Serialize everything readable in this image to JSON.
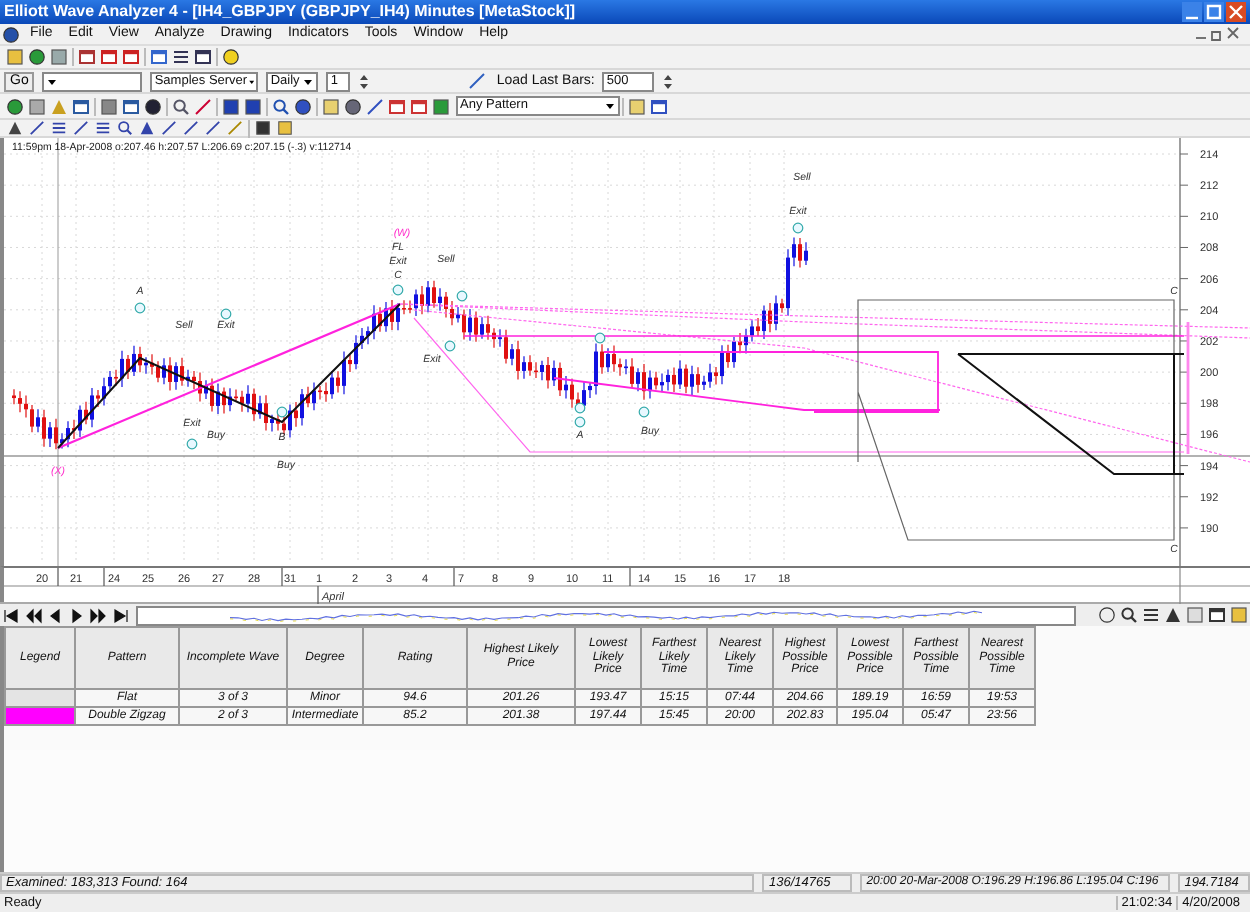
{
  "window": {
    "title": "Elliott Wave Analyzer 4 - [IH4_GBPJPY  (GBPJPY_IH4)  Minutes [MetaStock]]"
  },
  "menu": [
    "File",
    "Edit",
    "View",
    "Analyze",
    "Drawing",
    "Indicators",
    "Tools",
    "Window",
    "Help"
  ],
  "toolbar": {
    "go_button": "Go",
    "server_combo": "Samples Server",
    "period_combo": "Daily",
    "interval_field": "1",
    "load_bars_label": "Load Last Bars:",
    "load_bars_field": "500",
    "pattern_combo": "Any Pattern"
  },
  "chart": {
    "info": "11:59pm 18-Apr-2008 o:207.46 h:207.57 L:206.69 c:207.15 (-.3) v:112714",
    "y_labels": [
      "214",
      "212",
      "210",
      "208",
      "206",
      "204",
      "202",
      "200",
      "198",
      "196",
      "194",
      "192",
      "190"
    ],
    "x_labels": [
      "20",
      "21",
      "24",
      "25",
      "26",
      "27",
      "28",
      "31",
      "1",
      "2",
      "3",
      "4",
      "7",
      "8",
      "9",
      "10",
      "11",
      "14",
      "15",
      "16",
      "17",
      "18"
    ],
    "month_label": "April",
    "annotations": [
      {
        "text": "A",
        "kind": "signal"
      },
      {
        "text": "Sell",
        "kind": "signal"
      },
      {
        "text": "Exit",
        "kind": "signal"
      },
      {
        "text": "Exit",
        "kind": "signal"
      },
      {
        "text": "Buy",
        "kind": "signal"
      },
      {
        "text": "B",
        "kind": "signal"
      },
      {
        "text": "Buy",
        "kind": "signal"
      },
      {
        "text": "(W)",
        "kind": "degree"
      },
      {
        "text": "FL",
        "kind": "signal"
      },
      {
        "text": "Exit",
        "kind": "signal"
      },
      {
        "text": "C",
        "kind": "signal"
      },
      {
        "text": "Sell",
        "kind": "signal"
      },
      {
        "text": "Exit",
        "kind": "signal"
      },
      {
        "text": "A",
        "kind": "signal"
      },
      {
        "text": "Buy",
        "kind": "signal"
      },
      {
        "text": "Sell",
        "kind": "signal"
      },
      {
        "text": "Exit",
        "kind": "signal"
      },
      {
        "text": "(X)",
        "kind": "degree"
      },
      {
        "text": "C",
        "kind": "signal"
      },
      {
        "text": "C",
        "kind": "signal"
      }
    ]
  },
  "table": {
    "columns": [
      "Legend",
      "Pattern",
      "Incomplete Wave",
      "Degree",
      "Rating",
      "Highest Likely Price",
      "Lowest Likely Price",
      "Farthest Likely Time",
      "Nearest Likely Time",
      "Highest Possible Price",
      "Lowest Possible Price",
      "Farthest Possible Time",
      "Nearest Possible Time"
    ],
    "rows": [
      {
        "color": "#e4e4e4",
        "cells": [
          "",
          "Flat",
          "3 of 3",
          "Minor",
          "94.6",
          "201.26",
          "193.47",
          "15:15",
          "07:44",
          "204.66",
          "189.19",
          "16:59",
          "19:53"
        ]
      },
      {
        "color": "#ff00ff",
        "cells": [
          "",
          "Double Zigzag",
          "2 of 3",
          "Intermediate",
          "85.2",
          "201.38",
          "197.44",
          "15:45",
          "20:00",
          "202.83",
          "195.04",
          "05:47",
          "23:56"
        ]
      }
    ]
  },
  "status_bar": {
    "message": "Examined: 183,313  Found: 164",
    "position": "136/14765",
    "bar_info": "20:00 20-Mar-2008  O:196.29 H:196.86 L:195.04 C:196",
    "cursor_price": "194.7184",
    "ready": "Ready",
    "time": "21:02:34",
    "date": "4/20/2008"
  }
}
